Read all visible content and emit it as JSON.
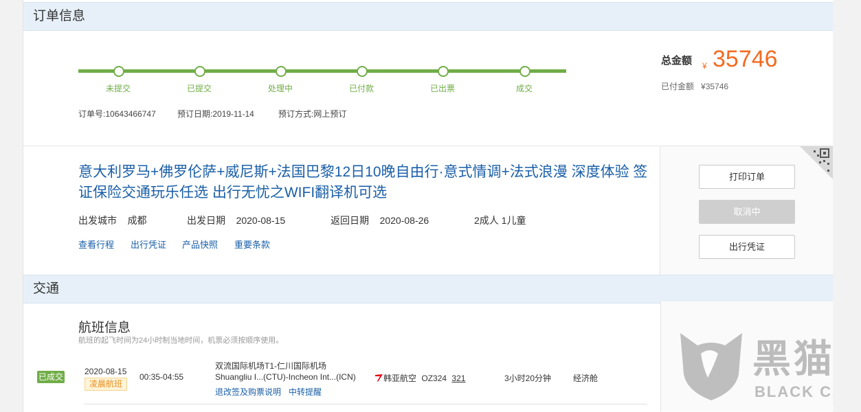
{
  "order_section": {
    "title": "订单信息"
  },
  "progress": {
    "steps": [
      "未提交",
      "已提交",
      "处理中",
      "已付款",
      "已出票",
      "成交"
    ]
  },
  "order_meta": {
    "order_no_label": "订单号:",
    "order_no": "10643466747",
    "order_date_label": "预订日期:",
    "order_date": "2019-11-14",
    "order_method_label": "预订方式:",
    "order_method": "网上预订"
  },
  "totals": {
    "total_label": "总金额",
    "currency": "¥",
    "total_amount": "35746",
    "paid_label": "已付金额",
    "paid_amount": "¥35746"
  },
  "product": {
    "title": "意大利罗马+佛罗伦萨+威尼斯+法国巴黎12日10晚自由行·意式情调+法式浪漫 深度体验 签证保险交通玩乐任选 出行无忧之WIFI翻译机可选",
    "depart_city_label": "出发城市",
    "depart_city": "成都",
    "depart_date_label": "出发日期",
    "depart_date": "2020-08-15",
    "return_date_label": "返回日期",
    "return_date": "2020-08-26",
    "travelers": "2成人 1儿童",
    "links": [
      "查看行程",
      "出行凭证",
      "产品快照",
      "重要条款"
    ]
  },
  "actions": {
    "print": "打印订单",
    "cancel": "取消中",
    "voucher": "出行凭证"
  },
  "transport_section": {
    "title": "交通"
  },
  "flight": {
    "heading": "航班信息",
    "note": "航班的起飞时间为24小时制当地时间，机票必须按顺序使用。",
    "status": "已成交",
    "date": "2020-08-15",
    "tag": "凌晨航班",
    "time": "00:35-04:55",
    "route_cn": "双流国际机场T1-仁川国际机场",
    "route_en": "Shuangliu I...(CTU)-Incheon Int...(ICN)",
    "airline": "韩亚航空",
    "flight_no": "OZ324",
    "aircraft": "321",
    "duration": "3小时20分钟",
    "cabin": "经济舱",
    "link_rules": "退改签及购票说明",
    "link_transfer": "中转提醒"
  },
  "watermark": {
    "cn": "黑猫",
    "en": "BLACK CAT"
  },
  "colors": {
    "accent_green": "#70ad47",
    "price_orange": "#f26c22",
    "link_blue": "#1a5fa8"
  }
}
